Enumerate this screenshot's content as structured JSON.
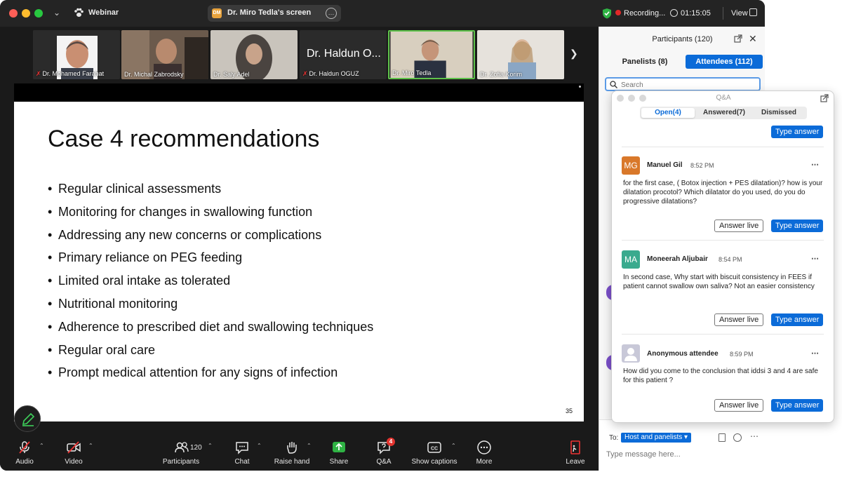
{
  "window": {
    "app_title": "Webinar",
    "screen_share_title": "Dr. Miro Tedla's screen",
    "screen_share_initials": "DM",
    "recording_label": "Recording...",
    "timer": "01:15:05",
    "view_label": "View"
  },
  "gallery": {
    "tiles": [
      {
        "name": "Dr. Mohamed Farahat",
        "muted": true
      },
      {
        "name": "Dr. Michal Zabrodsky",
        "muted": false
      },
      {
        "name": "Dr. Saly Adel",
        "muted": false
      },
      {
        "name": "Dr. Haldun OGUZ",
        "muted": true,
        "big_name": "Dr. Haldun O..."
      },
      {
        "name": "Dr. Miro Tedla",
        "muted": false,
        "active": true
      },
      {
        "name": "Dr. Zofia Korim",
        "muted": false
      }
    ]
  },
  "slide": {
    "title": "Case 4 recommendations",
    "bullets": [
      "Regular clinical assessments",
      "Monitoring for changes in swallowing function",
      "Addressing any new concerns or complications",
      "Primary reliance on PEG feeding",
      "Limited oral intake as tolerated",
      "Nutritional monitoring",
      "Adherence to prescribed diet and swallowing techniques",
      "Regular oral care",
      "Prompt medical attention for any signs of infection"
    ],
    "page_number": "35"
  },
  "toolbar": {
    "audio": "Audio",
    "video": "Video",
    "participants": "Participants",
    "participants_count": "120",
    "chat": "Chat",
    "raise_hand": "Raise hand",
    "share": "Share",
    "qa": "Q&A",
    "qa_badge": "4",
    "captions": "Show captions",
    "more": "More",
    "leave": "Leave"
  },
  "participants_panel": {
    "title": "Participants (120)",
    "tab_panelists": "Panelists (8)",
    "tab_attendees": "Attendees (112)",
    "search_placeholder": "Search",
    "to_label": "To:",
    "to_value": "Host and panelists ▾",
    "message_placeholder": "Type message here..."
  },
  "qa": {
    "title": "Q&A",
    "tabs": {
      "open": "Open(4)",
      "answered": "Answered(7)",
      "dismissed": "Dismissed"
    },
    "type_answer": "Type answer",
    "answer_live": "Answer live",
    "questions": [
      {
        "initials": "MG",
        "name": "Manuel Gil",
        "time": "8:52 PM",
        "avatar_color": "#d9782a",
        "text": "for the first case, ( Botox injection + PES dilatation)? how is your dilatation procotol? Which dilatator do you used, do you do progressive dilatations?"
      },
      {
        "initials": "MA",
        "name": "Moneerah Aljubair",
        "time": "8:54 PM",
        "avatar_color": "#3aaa8e",
        "text": "In second case, Why start with biscuit consistency in FEES if patient cannot swallow own saliva? Not an easier consistency"
      },
      {
        "initials": "",
        "name": "Anonymous attendee",
        "time": "8:59 PM",
        "avatar_color": "#c8c8d8",
        "text": "How did you come to the conclusion that iddsi 3 and 4 are safe for this patient ?"
      }
    ]
  },
  "colors": {
    "accent": "#0b6bd8",
    "active_tile_border": "#5ec24a",
    "badge": "#e3342f"
  }
}
